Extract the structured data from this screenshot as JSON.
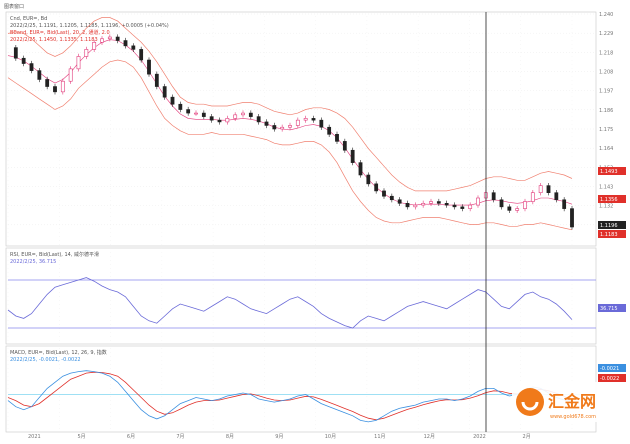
{
  "window": {
    "title": "图表窗口"
  },
  "main_panel": {
    "legend_line1": "Cnd, EUR=, Bd",
    "legend_line2": "2022/2/25, 1.1191, 1.1205, 1.1185, 1.1196, +0.0005 (+0.04%)",
    "legend_line3": "BBand, EUR=, Bid(Last), 20, 2, 通道, 2.0",
    "legend_line4": "2022/2/25, 1.1450, 1.1335, 1.1183",
    "price_tags": [
      {
        "value": "1.1493",
        "color": "#e0302a"
      },
      {
        "value": "1.1356",
        "color": "#e0302a"
      },
      {
        "value": "1.1196",
        "color": "#222222"
      },
      {
        "value": "1.1183",
        "color": "#e0302a"
      }
    ]
  },
  "rsi_panel": {
    "legend_line1": "RSI, EUR=, Bid(Last), 14, 威尔德平滑",
    "legend_line2": "2022/2/25, 36.715",
    "tag": "36.715"
  },
  "macd_panel": {
    "legend_line1": "MACD, EUR=, Bid(Last), 12, 26, 9, 指数",
    "legend_line2": "2022/2/25, -0.0021, -0.0022",
    "tags": [
      "-0.0021",
      "-0.0022"
    ]
  },
  "x_labels": [
    "2021",
    "5月",
    "6月",
    "7月",
    "8月",
    "9月",
    "10月",
    "11月",
    "12月",
    "2022",
    "2月"
  ],
  "watermark": {
    "text": "汇金网",
    "url": "www.gold678.com"
  },
  "colors": {
    "candle": "#222222",
    "bull": "#e23a7a",
    "band": "#f08070",
    "rsi": "#6a6ad8",
    "macd": "#3a8fe0",
    "signal": "#e0302a",
    "level": "#8888ee"
  },
  "chart_data": [
    {
      "type": "line",
      "name": "price",
      "x": [
        0,
        4,
        8,
        12,
        16,
        20,
        24,
        28,
        32,
        36,
        40,
        44,
        48,
        52,
        56,
        60,
        64,
        68,
        72,
        76,
        80,
        84,
        88,
        92,
        96,
        100,
        104,
        108,
        112,
        116,
        120,
        124,
        128,
        132,
        136,
        140,
        144,
        148,
        152,
        156,
        160,
        164,
        168,
        172,
        176,
        180,
        184,
        188,
        192,
        196,
        200,
        204,
        208,
        212,
        216,
        220,
        224,
        228,
        232,
        236,
        240,
        244,
        248,
        252,
        256,
        260,
        264,
        268,
        272,
        276,
        280,
        284,
        288
      ],
      "values": [
        1.221,
        1.215,
        1.212,
        1.208,
        1.203,
        1.199,
        1.196,
        1.202,
        1.209,
        1.216,
        1.22,
        1.224,
        1.226,
        1.227,
        1.225,
        1.222,
        1.22,
        1.214,
        1.206,
        1.199,
        1.193,
        1.189,
        1.186,
        1.184,
        1.184,
        1.182,
        1.18,
        1.179,
        1.181,
        1.183,
        1.184,
        1.182,
        1.179,
        1.177,
        1.175,
        1.176,
        1.177,
        1.18,
        1.181,
        1.18,
        1.176,
        1.172,
        1.168,
        1.163,
        1.156,
        1.149,
        1.144,
        1.14,
        1.137,
        1.135,
        1.133,
        1.131,
        1.132,
        1.133,
        1.134,
        1.133,
        1.132,
        1.131,
        1.13,
        1.132,
        1.136,
        1.139,
        1.135,
        1.131,
        1.129,
        1.13,
        1.134,
        1.139,
        1.143,
        1.139,
        1.135,
        1.13,
        1.1196
      ],
      "bb_upper": [
        1.229,
        1.23,
        1.229,
        1.226,
        1.222,
        1.218,
        1.216,
        1.218,
        1.222,
        1.227,
        1.232,
        1.236,
        1.238,
        1.238,
        1.236,
        1.232,
        1.228,
        1.224,
        1.219,
        1.213,
        1.206,
        1.199,
        1.193,
        1.19,
        1.189,
        1.189,
        1.188,
        1.188,
        1.188,
        1.189,
        1.19,
        1.19,
        1.189,
        1.187,
        1.185,
        1.184,
        1.183,
        1.184,
        1.186,
        1.187,
        1.187,
        1.186,
        1.184,
        1.181,
        1.176,
        1.17,
        1.164,
        1.159,
        1.154,
        1.149,
        1.145,
        1.142,
        1.14,
        1.14,
        1.14,
        1.14,
        1.14,
        1.141,
        1.142,
        1.143,
        1.145,
        1.147,
        1.148,
        1.148,
        1.147,
        1.146,
        1.146,
        1.148,
        1.15,
        1.151,
        1.15,
        1.149,
        1.147
      ],
      "bb_lower": [
        1.204,
        1.201,
        1.198,
        1.195,
        1.192,
        1.189,
        1.186,
        1.188,
        1.192,
        1.198,
        1.202,
        1.206,
        1.21,
        1.213,
        1.214,
        1.213,
        1.21,
        1.204,
        1.196,
        1.188,
        1.181,
        1.177,
        1.174,
        1.172,
        1.172,
        1.172,
        1.173,
        1.172,
        1.172,
        1.172,
        1.172,
        1.171,
        1.17,
        1.169,
        1.167,
        1.166,
        1.166,
        1.167,
        1.168,
        1.168,
        1.166,
        1.162,
        1.156,
        1.148,
        1.14,
        1.134,
        1.129,
        1.125,
        1.123,
        1.122,
        1.122,
        1.123,
        1.124,
        1.125,
        1.125,
        1.125,
        1.124,
        1.123,
        1.122,
        1.121,
        1.121,
        1.122,
        1.122,
        1.121,
        1.12,
        1.12,
        1.121,
        1.121,
        1.122,
        1.121,
        1.12,
        1.119,
        1.118
      ],
      "ylim": [
        1.11,
        1.24
      ]
    },
    {
      "type": "line",
      "name": "RSI",
      "values": [
        45,
        40,
        38,
        42,
        50,
        58,
        64,
        66,
        68,
        70,
        72,
        69,
        65,
        62,
        60,
        56,
        48,
        40,
        36,
        34,
        40,
        46,
        50,
        48,
        46,
        44,
        48,
        52,
        56,
        54,
        50,
        46,
        44,
        42,
        46,
        50,
        54,
        56,
        52,
        48,
        42,
        38,
        35,
        32,
        30,
        36,
        40,
        38,
        36,
        40,
        44,
        48,
        50,
        52,
        50,
        48,
        46,
        50,
        54,
        58,
        62,
        60,
        54,
        48,
        46,
        52,
        58,
        60,
        56,
        54,
        50,
        44,
        37
      ],
      "ylim": [
        20,
        80
      ],
      "levels": [
        70,
        30
      ],
      "current": 36.715
    },
    {
      "type": "line",
      "name": "MACD",
      "macd": [
        -0.002,
        -0.004,
        -0.005,
        -0.004,
        -0.001,
        0.002,
        0.004,
        0.006,
        0.007,
        0.0075,
        0.0078,
        0.0075,
        0.007,
        0.006,
        0.004,
        0.001,
        -0.002,
        -0.005,
        -0.007,
        -0.008,
        -0.007,
        -0.005,
        -0.003,
        -0.002,
        -0.001,
        -0.0015,
        -0.002,
        -0.0015,
        -0.0005,
        0.0,
        0.0005,
        0.0,
        -0.0015,
        -0.002,
        -0.0025,
        -0.002,
        -0.0015,
        -0.0005,
        0.0,
        -0.0015,
        -0.003,
        -0.004,
        -0.005,
        -0.006,
        -0.007,
        -0.0085,
        -0.009,
        -0.0085,
        -0.007,
        -0.0055,
        -0.0045,
        -0.004,
        -0.0035,
        -0.0025,
        -0.002,
        -0.0015,
        -0.0015,
        -0.002,
        -0.0015,
        -0.0005,
        0.001,
        0.002,
        0.002,
        0.0005,
        -0.0005,
        0.0,
        0.0015,
        0.0025,
        0.002,
        0.0005,
        -0.001,
        -0.0018,
        -0.0021
      ],
      "signal": [
        -0.001,
        -0.002,
        -0.0035,
        -0.004,
        -0.003,
        -0.001,
        0.001,
        0.003,
        0.005,
        0.006,
        0.007,
        0.0073,
        0.0072,
        0.0068,
        0.006,
        0.004,
        0.0015,
        -0.001,
        -0.0035,
        -0.0055,
        -0.0065,
        -0.006,
        -0.0048,
        -0.0035,
        -0.0025,
        -0.002,
        -0.002,
        -0.0018,
        -0.0012,
        -0.0006,
        0.0,
        0.0002,
        -0.0004,
        -0.0012,
        -0.0018,
        -0.002,
        -0.0018,
        -0.0012,
        -0.0006,
        -0.0008,
        -0.0016,
        -0.0026,
        -0.0036,
        -0.0046,
        -0.0056,
        -0.0068,
        -0.0078,
        -0.0083,
        -0.0078,
        -0.0068,
        -0.0058,
        -0.0049,
        -0.0042,
        -0.0034,
        -0.0027,
        -0.0021,
        -0.0017,
        -0.0018,
        -0.0017,
        -0.0012,
        -0.0004,
        0.0006,
        0.0012,
        0.001,
        0.0004,
        0.0002,
        0.0007,
        0.0014,
        0.0017,
        0.0012,
        0.0004,
        -0.0006,
        -0.0022
      ],
      "ylim": [
        -0.011,
        0.01
      ],
      "zero_line": 0
    }
  ]
}
